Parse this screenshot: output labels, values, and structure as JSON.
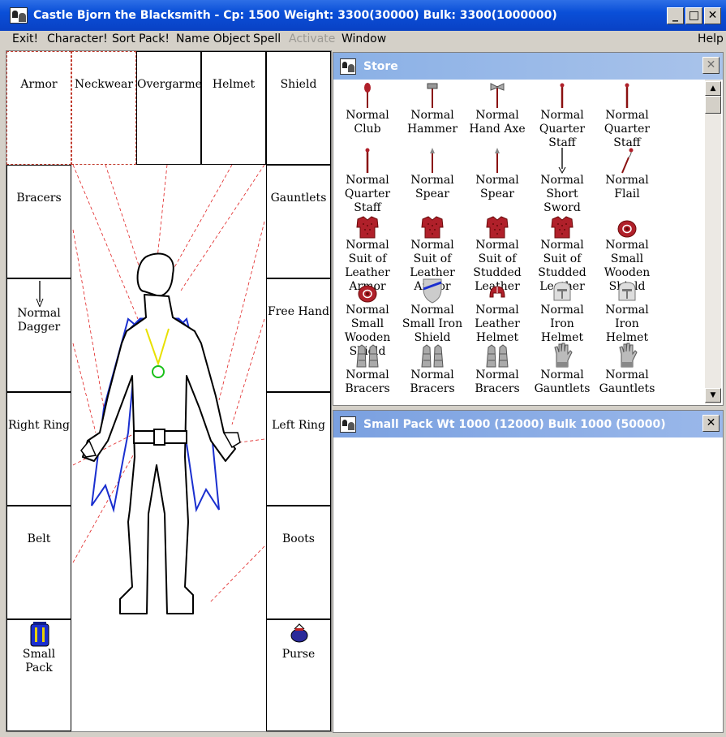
{
  "window": {
    "title": "Castle Bjorn the Blacksmith - Cp: 1500 Weight: 3300(30000) Bulk: 3300(1000000)",
    "minimize": "_",
    "maximize": "□",
    "close": "✕"
  },
  "menu": {
    "exit": "Exit!",
    "character": "Character!",
    "sort_pack": "Sort Pack!",
    "name_object": "Name Object",
    "spell": "Spell",
    "activate": "Activate",
    "window": "Window",
    "help": "Help"
  },
  "equipment": {
    "armor": "Armor",
    "neckwear": "Neckwear",
    "overgarment": "Overgarment",
    "helmet": "Helmet",
    "shield": "Shield",
    "bracers": "Bracers",
    "gauntlets": "Gauntlets",
    "weapon_item": "Normal Dagger",
    "free_hand": "Free Hand",
    "right_ring": "Right Ring",
    "left_ring": "Left Ring",
    "belt": "Belt",
    "boots": "Boots",
    "small_pack": "Small Pack",
    "purse": "Purse"
  },
  "store": {
    "title": "Store",
    "close": "✕",
    "items": [
      {
        "name": "Normal Club",
        "icon": "club-icon"
      },
      {
        "name": "Normal Hammer",
        "icon": "hammer-icon"
      },
      {
        "name": "Normal Hand Axe",
        "icon": "hand-axe-icon"
      },
      {
        "name": "Normal Quarter Staff",
        "icon": "staff-icon"
      },
      {
        "name": "Normal Quarter Staff",
        "icon": "staff-icon"
      },
      {
        "name": "Normal Quarter Staff",
        "icon": "staff-icon"
      },
      {
        "name": "Normal Spear",
        "icon": "spear-icon"
      },
      {
        "name": "Normal Spear",
        "icon": "spear-icon"
      },
      {
        "name": "Normal Short Sword",
        "icon": "short-sword-icon"
      },
      {
        "name": "Normal Flail",
        "icon": "flail-icon"
      },
      {
        "name": "Normal Suit of Leather Armor",
        "icon": "armor-icon"
      },
      {
        "name": "Normal Suit of Leather Armor",
        "icon": "armor-icon"
      },
      {
        "name": "Normal Suit of Studded Leather",
        "icon": "armor-icon"
      },
      {
        "name": "Normal Suit of Studded Leather",
        "icon": "armor-icon"
      },
      {
        "name": "Normal Small Wooden Shield",
        "icon": "wooden-shield-icon"
      },
      {
        "name": "Normal Small Wooden Shield",
        "icon": "wooden-shield-icon"
      },
      {
        "name": "Normal Small Iron Shield",
        "icon": "iron-shield-icon"
      },
      {
        "name": "Normal Leather Helmet",
        "icon": "leather-helmet-icon"
      },
      {
        "name": "Normal Iron Helmet",
        "icon": "iron-helmet-icon"
      },
      {
        "name": "Normal Iron Helmet",
        "icon": "iron-helmet-icon"
      },
      {
        "name": "Normal Bracers",
        "icon": "bracers-icon"
      },
      {
        "name": "Normal Bracers",
        "icon": "bracers-icon"
      },
      {
        "name": "Normal Bracers",
        "icon": "bracers-icon"
      },
      {
        "name": "Normal Gauntlets",
        "icon": "gauntlets-icon"
      },
      {
        "name": "Normal Gauntlets",
        "icon": "gauntlets-icon"
      }
    ],
    "scroll_up": "▲",
    "scroll_down": "▼"
  },
  "pack": {
    "title": "Small Pack Wt 1000 (12000) Bulk 1000 (50000)",
    "close": "✕"
  },
  "colors": {
    "titlebar": "#0a4fd8",
    "subtitle": "#9ab8ea",
    "armor_red": "#b0202a",
    "cape_blue": "#1a2fcf",
    "necklace_yellow": "#e8e000",
    "amulet_green": "#19c019",
    "guide_lines": "#e02020"
  }
}
